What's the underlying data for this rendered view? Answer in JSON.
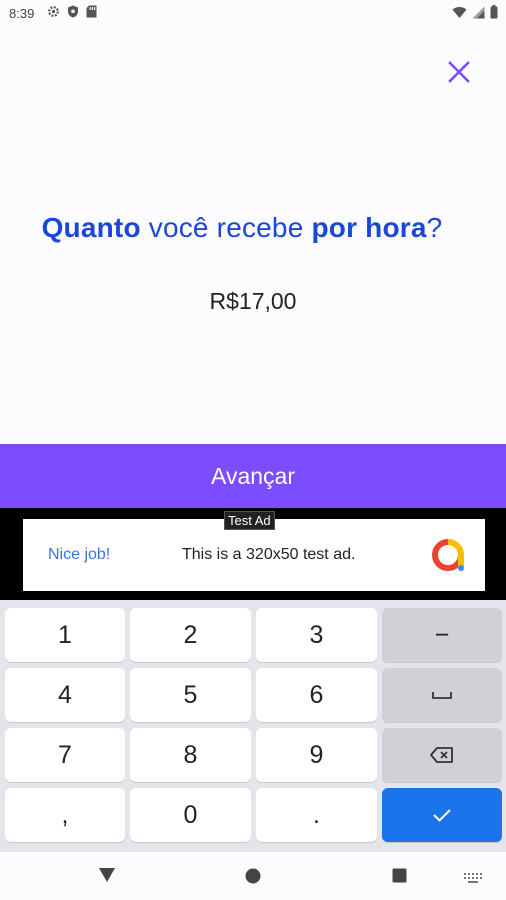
{
  "status_bar": {
    "time": "8:39"
  },
  "question": {
    "part1": "Quanto",
    "part2": " você recebe ",
    "part3": "por hora",
    "part4": "?"
  },
  "amount": {
    "value": "R$17,00"
  },
  "advance_button": {
    "label": "Avançar"
  },
  "ad": {
    "label": "Test Ad",
    "headline": "Nice job!",
    "body": "This is a 320x50 test ad."
  },
  "keyboard": {
    "keys": [
      "1",
      "2",
      "3",
      "−",
      "4",
      "5",
      "6",
      "⎵",
      "7",
      "8",
      "9",
      "⌫",
      ",",
      "0",
      ".",
      "✓"
    ]
  },
  "colors": {
    "accent": "#7c4dff",
    "question_blue": "#1a47d8",
    "confirm_key": "#1a73e8"
  }
}
